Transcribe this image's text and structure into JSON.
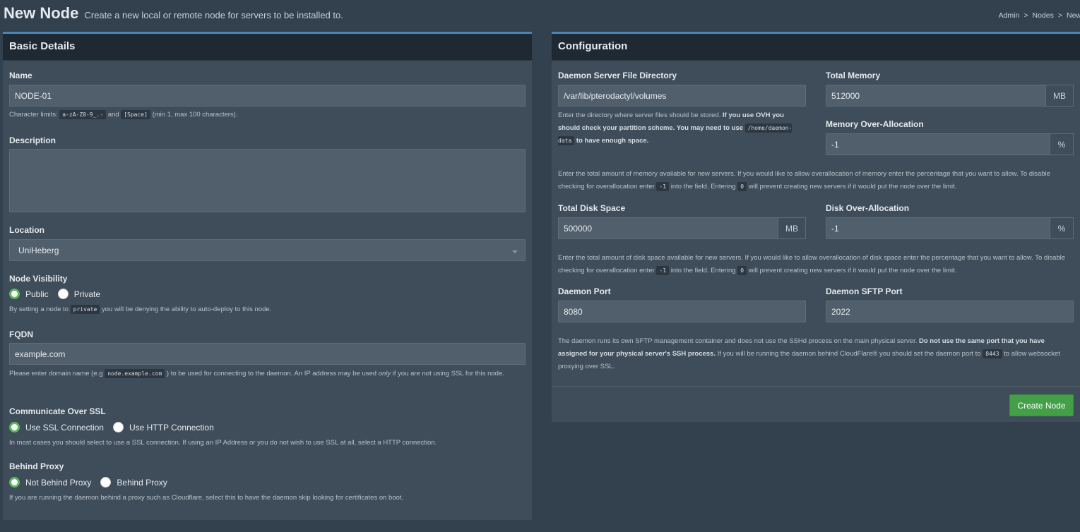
{
  "header": {
    "title": "New Node",
    "subtitle": "Create a new local or remote node for servers to be installed to.",
    "breadcrumb": [
      "Admin",
      "Nodes",
      "New"
    ]
  },
  "basic": {
    "title": "Basic Details",
    "name": {
      "label": "Name",
      "value": "NODE-01",
      "help_prefix": "Character limits:",
      "code1": "a-zA-Z0-9_.-",
      "and": "and",
      "code2": "[Space]",
      "help_suffix": "(min 1, max 100 characters)."
    },
    "description": {
      "label": "Description",
      "value": ""
    },
    "location": {
      "label": "Location",
      "value": "UniHeberg"
    },
    "visibility": {
      "label": "Node Visibility",
      "option1": "Public",
      "option2": "Private",
      "selected": "Public",
      "help_prefix": "By setting a node to",
      "code": "private",
      "help_suffix": "you will be denying the ability to auto-deploy to this node."
    },
    "fqdn": {
      "label": "FQDN",
      "value": "example.com",
      "help1": "Please enter domain name (e.g",
      "code": "node.example.com",
      "help2": ") to be used for connecting to the daemon. An IP address may be used",
      "help_em": "only",
      "help3": "if you are not using SSL for this node."
    },
    "ssl": {
      "label": "Communicate Over SSL",
      "option1": "Use SSL Connection",
      "option2": "Use HTTP Connection",
      "selected": "Use SSL Connection",
      "help": "In most cases you should select to use a SSL connection. If using an IP Address or you do not wish to use SSL at all, select a HTTP connection."
    },
    "proxy": {
      "label": "Behind Proxy",
      "option1": "Not Behind Proxy",
      "option2": "Behind Proxy",
      "selected": "Not Behind Proxy",
      "help": "If you are running the daemon behind a proxy such as Cloudflare, select this to have the daemon skip looking for certificates on boot."
    }
  },
  "config": {
    "title": "Configuration",
    "directory": {
      "label": "Daemon Server File Directory",
      "value": "/var/lib/pterodactyl/volumes",
      "help1": "Enter the directory where server files should be stored.",
      "help_bold": "If you use OVH you should check your partition scheme. You may need to use",
      "code": "/home/daemon-data",
      "help_bold2": "to have enough space."
    },
    "memory": {
      "label": "Total Memory",
      "value": "512000",
      "unit": "MB"
    },
    "memory_over": {
      "label": "Memory Over-Allocation",
      "value": "-1",
      "unit": "%"
    },
    "memory_help": {
      "p1": "Enter the total amount of memory available for new servers. If you would like to allow overallocation of memory enter the percentage that you want to allow.",
      "p2": "To disable checking for overallocation enter",
      "code1": "-1",
      "p3": "into the field. Entering",
      "code2": "0",
      "p4": "will prevent creating new servers if it would put the node over the limit."
    },
    "disk": {
      "label": "Total Disk Space",
      "value": "500000",
      "unit": "MB"
    },
    "disk_over": {
      "label": "Disk Over-Allocation",
      "value": "-1",
      "unit": "%"
    },
    "disk_help": {
      "p1": "Enter the total amount of disk space available for new servers. If you would like to allow overallocation of disk space enter the percentage that you want to",
      "p2": "allow. To disable checking for overallocation enter",
      "code1": "-1",
      "p3": "into the field. Entering",
      "code2": "0",
      "p4": "will prevent creating new servers if it would put the node over the limit."
    },
    "port": {
      "label": "Daemon Port",
      "value": "8080"
    },
    "sftp_port": {
      "label": "Daemon SFTP Port",
      "value": "2022"
    },
    "port_help": {
      "p1": "The daemon runs its own SFTP management container and does not use the SSHd process on the main physical server.",
      "bold": "Do not use the same port that you have assigned for your physical server's SSH process.",
      "p2": "If you will be running the daemon behind CloudFlare® you should set the daemon port to",
      "code": "8443",
      "p3": "to allow websocket proxying over SSL."
    },
    "submit": "Create Node"
  },
  "colors": {
    "header_bg": "#1f2933",
    "panel_bg": "#3f4d5a",
    "accent": "#4b84b3",
    "success": "#43a047"
  }
}
